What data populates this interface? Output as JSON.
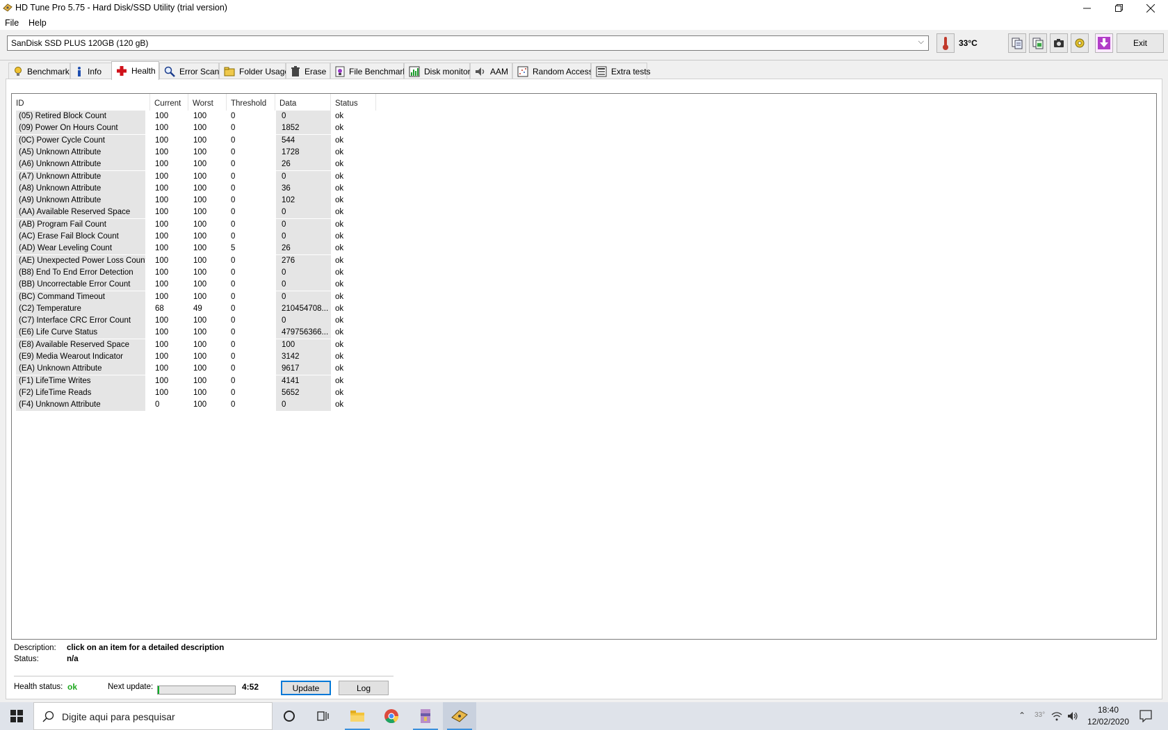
{
  "window": {
    "title": "HD Tune Pro 5.75 - Hard Disk/SSD Utility (trial version)"
  },
  "menu": [
    "File",
    "Help"
  ],
  "drive": {
    "name": "SanDisk SSD PLUS 120GB (120 gB)",
    "temperature": "33°C"
  },
  "toolbar": {
    "exit_label": "Exit"
  },
  "tabs": [
    {
      "label": "Benchmark",
      "icon": "benchmark-icon"
    },
    {
      "label": "Info",
      "icon": "info-icon"
    },
    {
      "label": "Health",
      "icon": "health-cross-icon",
      "active": true
    },
    {
      "label": "Error Scan",
      "icon": "magnifier-icon"
    },
    {
      "label": "Folder Usage",
      "icon": "folder-icon"
    },
    {
      "label": "Erase",
      "icon": "trash-icon"
    },
    {
      "label": "File Benchmark",
      "icon": "file-benchmark-icon"
    },
    {
      "label": "Disk monitor",
      "icon": "chart-icon"
    },
    {
      "label": "AAM",
      "icon": "speaker-icon"
    },
    {
      "label": "Random Access",
      "icon": "random-access-icon"
    },
    {
      "label": "Extra tests",
      "icon": "extra-tests-icon"
    }
  ],
  "table": {
    "columns": [
      "ID",
      "Current",
      "Worst",
      "Threshold",
      "Data",
      "Status"
    ],
    "rows": [
      [
        "(05) Retired Block Count",
        "100",
        "100",
        "0",
        "0",
        "ok"
      ],
      [
        "(09) Power On Hours Count",
        "100",
        "100",
        "0",
        "1852",
        "ok"
      ],
      [
        "(0C) Power Cycle Count",
        "100",
        "100",
        "0",
        "544",
        "ok"
      ],
      [
        "(A5) Unknown Attribute",
        "100",
        "100",
        "0",
        "1728",
        "ok"
      ],
      [
        "(A6) Unknown Attribute",
        "100",
        "100",
        "0",
        "26",
        "ok"
      ],
      [
        "(A7) Unknown Attribute",
        "100",
        "100",
        "0",
        "0",
        "ok"
      ],
      [
        "(A8) Unknown Attribute",
        "100",
        "100",
        "0",
        "36",
        "ok"
      ],
      [
        "(A9) Unknown Attribute",
        "100",
        "100",
        "0",
        "102",
        "ok"
      ],
      [
        "(AA) Available Reserved Space",
        "100",
        "100",
        "0",
        "0",
        "ok"
      ],
      [
        "(AB) Program Fail Count",
        "100",
        "100",
        "0",
        "0",
        "ok"
      ],
      [
        "(AC) Erase Fail Block Count",
        "100",
        "100",
        "0",
        "0",
        "ok"
      ],
      [
        "(AD) Wear Leveling Count",
        "100",
        "100",
        "5",
        "26",
        "ok"
      ],
      [
        "(AE) Unexpected Power Loss Count",
        "100",
        "100",
        "0",
        "276",
        "ok"
      ],
      [
        "(B8) End To End Error Detection",
        "100",
        "100",
        "0",
        "0",
        "ok"
      ],
      [
        "(BB) Uncorrectable Error Count",
        "100",
        "100",
        "0",
        "0",
        "ok"
      ],
      [
        "(BC) Command Timeout",
        "100",
        "100",
        "0",
        "0",
        "ok"
      ],
      [
        "(C2) Temperature",
        "68",
        "49",
        "0",
        "210454708...",
        "ok"
      ],
      [
        "(C7) Interface CRC Error Count",
        "100",
        "100",
        "0",
        "0",
        "ok"
      ],
      [
        "(E6) Life Curve Status",
        "100",
        "100",
        "0",
        "479756366...",
        "ok"
      ],
      [
        "(E8) Available Reserved Space",
        "100",
        "100",
        "0",
        "100",
        "ok"
      ],
      [
        "(E9) Media Wearout Indicator",
        "100",
        "100",
        "0",
        "3142",
        "ok"
      ],
      [
        "(EA) Unknown Attribute",
        "100",
        "100",
        "0",
        "9617",
        "ok"
      ],
      [
        "(F1) LifeTime Writes",
        "100",
        "100",
        "0",
        "4141",
        "ok"
      ],
      [
        "(F2) LifeTime Reads",
        "100",
        "100",
        "0",
        "5652",
        "ok"
      ],
      [
        "(F4) Unknown Attribute",
        "0",
        "100",
        "0",
        "0",
        "ok"
      ]
    ]
  },
  "details": {
    "description_label": "Description:",
    "description_value": "click on an item for a detailed description",
    "status_label": "Status:",
    "status_value": "n/a"
  },
  "footer": {
    "health_label": "Health status:",
    "health_value": "ok",
    "next_update_label": "Next update:",
    "next_update_progress": 0.02,
    "countdown": "4:52",
    "update_label": "Update",
    "log_label": "Log"
  },
  "taskbar": {
    "search_placeholder": "Digite aqui para pesquisar",
    "clock_time": "18:40",
    "clock_date": "12/02/2020",
    "tray_temp": "33°"
  },
  "colors": {
    "health_ok": "#1fa81f",
    "progress_fill": "#06b025",
    "accent": "#0078d7"
  }
}
